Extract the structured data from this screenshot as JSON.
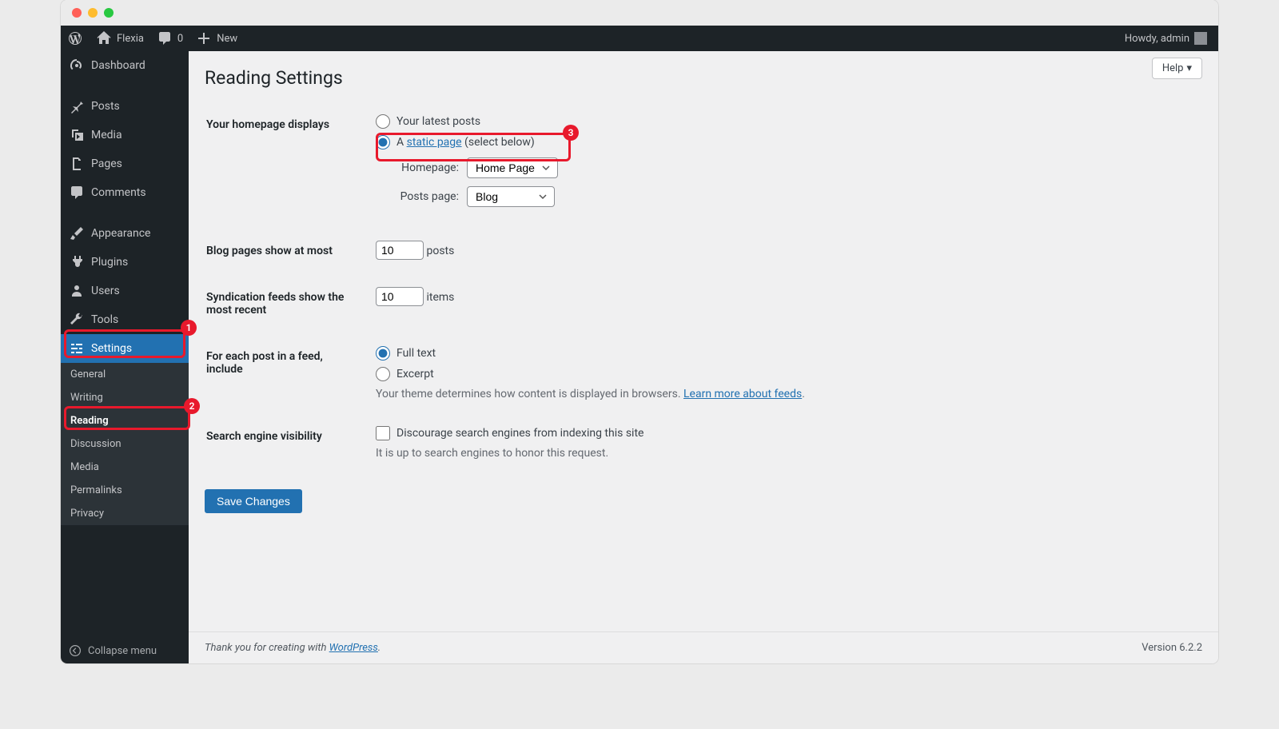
{
  "adminbar": {
    "site_name": "Flexia",
    "comments_count": "0",
    "new_label": "New",
    "howdy": "Howdy, admin"
  },
  "sidebar": {
    "dashboard": "Dashboard",
    "posts": "Posts",
    "media": "Media",
    "pages": "Pages",
    "comments": "Comments",
    "appearance": "Appearance",
    "plugins": "Plugins",
    "users": "Users",
    "tools": "Tools",
    "settings": "Settings",
    "sub_general": "General",
    "sub_writing": "Writing",
    "sub_reading": "Reading",
    "sub_discussion": "Discussion",
    "sub_media": "Media",
    "sub_permalinks": "Permalinks",
    "sub_privacy": "Privacy",
    "collapse": "Collapse menu"
  },
  "help_label": "Help",
  "page_title": "Reading Settings",
  "form": {
    "homepage_displays_label": "Your homepage displays",
    "latest_posts_label": "Your latest posts",
    "static_page_prefix": "A ",
    "static_page_link": "static page",
    "static_page_suffix": " (select below)",
    "homepage_label": "Homepage:",
    "homepage_value": "Home Page",
    "posts_page_label": "Posts page:",
    "posts_page_value": "Blog",
    "blog_pages_label": "Blog pages show at most",
    "blog_pages_value": "10",
    "blog_pages_unit": "posts",
    "syndication_label": "Syndication feeds show the most recent",
    "syndication_value": "10",
    "syndication_unit": "items",
    "feed_include_label": "For each post in a feed, include",
    "full_text_label": "Full text",
    "excerpt_label": "Excerpt",
    "feed_description_prefix": "Your theme determines how content is displayed in browsers. ",
    "feed_description_link": "Learn more about feeds",
    "search_visibility_label": "Search engine visibility",
    "discourage_label": "Discourage search engines from indexing this site",
    "discourage_note": "It is up to search engines to honor this request.",
    "save_button": "Save Changes"
  },
  "footer": {
    "thanks_prefix": "Thank you for creating with ",
    "wp_link": "WordPress",
    "version": "Version 6.2.2"
  },
  "annotations": {
    "b1": "1",
    "b2": "2",
    "b3": "3"
  }
}
